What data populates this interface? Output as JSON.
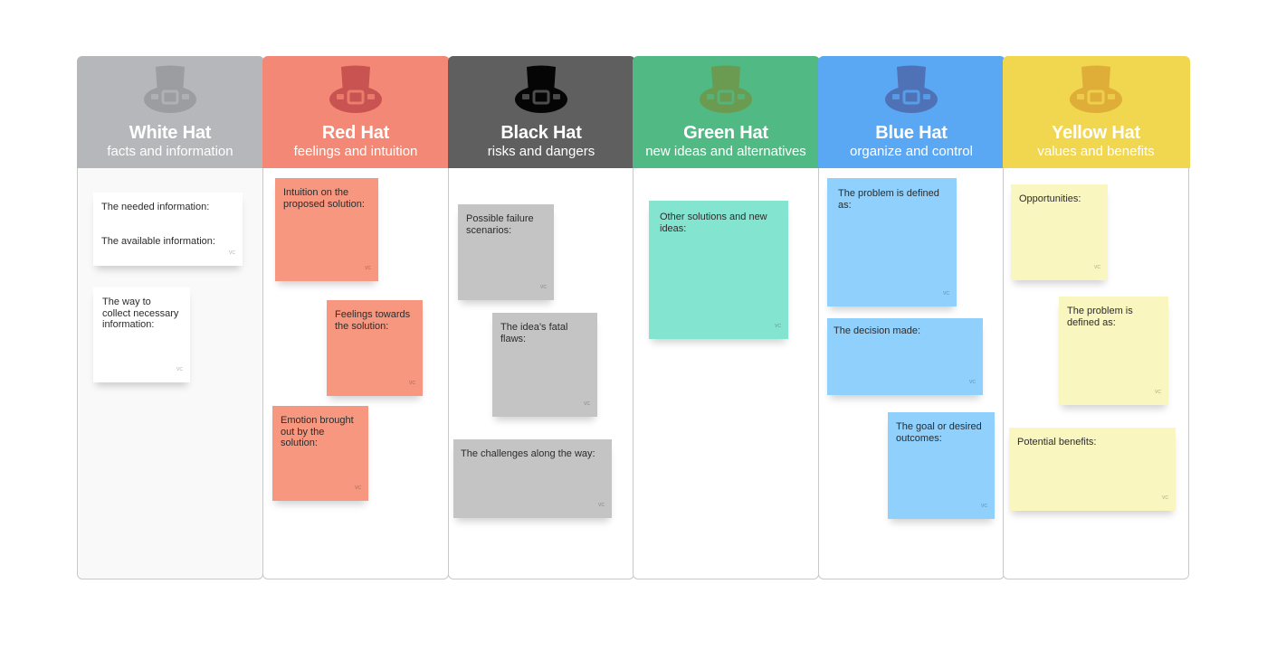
{
  "board": {
    "columns": [
      {
        "title": "White Hat",
        "subtitle": "facts and information",
        "header_color": "#b6b7ba",
        "hat_color": "#9c9da0",
        "buckle_color": "#b6b7ba",
        "notes": [
          {
            "lines": [
              "The needed information:",
              "The available information:"
            ],
            "color": "#ffffff",
            "signature": "VC"
          },
          {
            "lines": [
              "The way to collect necessary information:"
            ],
            "color": "#ffffff",
            "signature": "VC"
          }
        ]
      },
      {
        "title": "Red Hat",
        "subtitle": "feelings and intuition",
        "header_color": "#f38876",
        "hat_color": "#c95350",
        "buckle_color": "#f38876",
        "notes": [
          {
            "lines": [
              "Intuition on the proposed solution:"
            ],
            "color": "#f8977f",
            "signature": "VC"
          },
          {
            "lines": [
              "Feelings towards the solution:"
            ],
            "color": "#f8977f",
            "signature": "VC"
          },
          {
            "lines": [
              "Emotion brought out by the solution:"
            ],
            "color": "#f8977f",
            "signature": "VC"
          }
        ]
      },
      {
        "title": "Black Hat",
        "subtitle": "risks and dangers",
        "header_color": "#5f5f5f",
        "hat_color": "#050505",
        "buckle_color": "#5f5f5f",
        "notes": [
          {
            "lines": [
              "Possible failure scenarios:"
            ],
            "color": "#c4c4c4",
            "signature": "VC"
          },
          {
            "lines": [
              "The idea’s fatal flaws:"
            ],
            "color": "#c4c4c4",
            "signature": "VC"
          },
          {
            "lines": [
              "The challenges along the way:"
            ],
            "color": "#c4c4c4",
            "signature": "VC"
          }
        ]
      },
      {
        "title": "Green Hat",
        "subtitle": "new ideas and alternatives",
        "header_color": "#51b983",
        "hat_color": "#6a9b51",
        "buckle_color": "#51b983",
        "notes": [
          {
            "lines": [
              "Other solutions and new ideas:"
            ],
            "color": "#83e5d0",
            "signature": "VC"
          }
        ]
      },
      {
        "title": "Blue Hat",
        "subtitle": "organize and control",
        "header_color": "#5aa8f4",
        "hat_color": "#4f72b7",
        "buckle_color": "#5aa8f4",
        "notes": [
          {
            "lines": [
              "The problem is defined as:"
            ],
            "color": "#8fd0fc",
            "signature": "VC"
          },
          {
            "lines": [
              "The decision made:"
            ],
            "color": "#8fd0fc",
            "signature": "VC"
          },
          {
            "lines": [
              "The goal or desired outcomes:"
            ],
            "color": "#8fd0fc",
            "signature": "VC"
          }
        ]
      },
      {
        "title": "Yellow Hat",
        "subtitle": "values and benefits",
        "header_color": "#f1d64f",
        "hat_color": "#deae38",
        "buckle_color": "#f1d64f",
        "notes": [
          {
            "lines": [
              "Opportunities:"
            ],
            "color": "#faf6c0",
            "signature": "VC"
          },
          {
            "lines": [
              "The problem is defined as:"
            ],
            "color": "#faf6c0",
            "signature": "VC"
          },
          {
            "lines": [
              "Potential benefits:"
            ],
            "color": "#faf6c0",
            "signature": "VC"
          }
        ]
      }
    ]
  }
}
